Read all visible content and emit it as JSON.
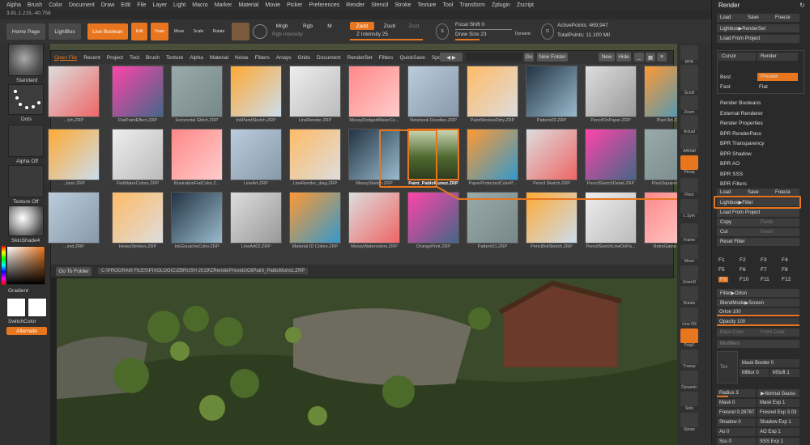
{
  "menu": [
    "Alpha",
    "Brush",
    "Color",
    "Document",
    "Draw",
    "Edit",
    "File",
    "Layer",
    "Light",
    "Macro",
    "Marker",
    "Material",
    "Movie",
    "Picker",
    "Preferences",
    "Render",
    "Stencil",
    "Stroke",
    "Texture",
    "Tool",
    "Transform",
    "Zplugin",
    "Zscript"
  ],
  "version": "3.81.1.215,-40.758",
  "topbar": {
    "home_page": "Home Page",
    "lightbox": "LightBox",
    "live_boolean": "Live Boolean",
    "edit": "Edit",
    "draw": "Draw",
    "move": "Move",
    "scale": "Scale",
    "rotate": "Rotate",
    "mrgb": "Mrgb",
    "rgb": "Rgb",
    "m": "M",
    "zadd": "Zadd",
    "zsub": "Zsub",
    "zcut": "Zcut",
    "rgb_intensity": "Rgb Intensity",
    "z_intensity": "Z Intensity 25",
    "focal_shift": "Focal Shift 0",
    "draw_size": "Draw Size 23",
    "dynamic": "Dynamic",
    "active_points": "ActivePoints: 469,947",
    "total_points": "TotalPoints: 11.100 Mil"
  },
  "left": {
    "standard": "Standard",
    "dots": "Dots",
    "alpha_off": "Alpha Off",
    "texture_off": "Texture Off",
    "skinshade": "SkinShade4",
    "gradient": "Gradient",
    "switchcolor": "SwitchColor",
    "alternate": "Alternate"
  },
  "lightbox": {
    "tabs": [
      "Open File",
      "Recent",
      "Project",
      "Tool",
      "Brush",
      "Texture",
      "Alpha",
      "Material",
      "Noise",
      "Fibers",
      "Arrays",
      "Grids",
      "Document",
      "RenderSet",
      "Filters",
      "QuickSave",
      "Spotlight"
    ],
    "active_tab": "Open File",
    "go": "Go",
    "new_folder": "New Folder",
    "new": "New",
    "hide": "Hide",
    "go_to_folder": "Go To Folder",
    "path": "C:\\PROGRAM FILES\\PIXOLOGIC\\ZBRUSH 2019\\ZRenderPresets\\OilPaint_PabloMunoz.ZRP",
    "row1": [
      "...tch.ZRP",
      "FlatPaintEffect.ZRP",
      "Horizontal Glitch.ZRP",
      "InkPaintSketch.ZRP",
      "LineRender.ZRP",
      "MessyDodgedWaterCo...",
      "Notebook Doodles.ZRP",
      "PaintStrokesDirty.ZRP",
      "Pattern02.ZRP",
      "PencilOnPaper.ZRP",
      "Pixel Art.ZRP"
    ],
    "row2": [
      "...toon.ZRP",
      "FlatWaterColors.ZRP",
      "IllustrationFlatColor.Z...",
      "LineArt.ZRP",
      "LineRender_diag.ZRP",
      "MessySketch.ZRP",
      "Paint_PabloMunoz.ZRP",
      "PaperProtectedColorP...",
      "Pencil Sketch.ZRP",
      "PencilSketchDetail.ZRP",
      "PixelSquares.ZRP"
    ],
    "row3": [
      "...zed.ZRP",
      "HeavyStrokes.ZRP",
      "InkGouacheColor.ZRP",
      "LineArt02.ZRP",
      "Material ID Colors.ZRP",
      "MessyWatercolors.ZRP",
      "OrangePrint.ZRP",
      "Pattern01.ZRP",
      "PencilInkSketch.ZRP",
      "PencilSketchLineOnPa...",
      "RetroGame.ZRP"
    ],
    "selected": "Paint_PabloMunoz.ZRP"
  },
  "shelf": [
    "BPR",
    "SPix 3",
    "Scroll",
    "Zoom",
    "Actual",
    "AAHalf",
    "Persp",
    "Floor",
    "L.Sym",
    "Frame",
    "Move",
    "ZoomD",
    "Rotate",
    "Line Fill",
    "PolyF",
    "Transp",
    "Dynamic",
    "Solo",
    "Xpose"
  ],
  "render": {
    "title": "Render",
    "load": "Load",
    "save": "Save",
    "freeze": "Freeze",
    "lightbox_renderset": "Lightbox▶RenderSet",
    "load_from_project": "Load From Project",
    "cursor": "Cursor",
    "render": "Render",
    "best": "Best",
    "preview": "Preview",
    "fast": "Fast",
    "flat": "Flat",
    "items": [
      "Render Booleans",
      "External Renderer",
      "Render Properties",
      "BPR RenderPass",
      "BPR Transparency",
      "BPR Shadow",
      "BPR AO",
      "BPR SSS",
      "BPR Filters"
    ],
    "lightbox_filter": "Lightbox▶Filter",
    "copy": "Copy",
    "paste": "Paste",
    "cut": "Cut",
    "insert": "Insert",
    "reset_filter": "Reset Filter",
    "filters": [
      "F1",
      "F2",
      "F3",
      "F4",
      "F5",
      "F6",
      "F7",
      "F8",
      "F9",
      "F10",
      "F11",
      "F12"
    ],
    "filter_orton": "Filter▶Orton",
    "blendmode": "BlendMode▶Screen",
    "orton": "Orton 100",
    "opacity": "Opacity 100",
    "back_color": "Back Color",
    "front_color": "Front Color",
    "modifiers": "Modifiers",
    "tex": "Tex",
    "mask_border": "Mask Border 0",
    "mblur": "MBlur 0",
    "msoft": "MSoft 1",
    "radius": "Radius 3",
    "normal_gauss": "▶Normal Gauss",
    "mask": "Mask 0",
    "mask_exp": "Mask Exp 1",
    "fresnel": "Fresnel 0.28767",
    "fresnel_exp": "Fresnel Exp 3.03",
    "shadow": "Shadow 0",
    "shadow_exp": "Shadow Exp 1",
    "ao": "Ao 0",
    "ao_exp": "AO Exp 1",
    "sss": "Sss 0",
    "sss_exp": "SSS Exp 1"
  },
  "colors": {
    "accent": "#e8761f",
    "panel": "#2a2a2a",
    "highlight": "#e8761f"
  }
}
